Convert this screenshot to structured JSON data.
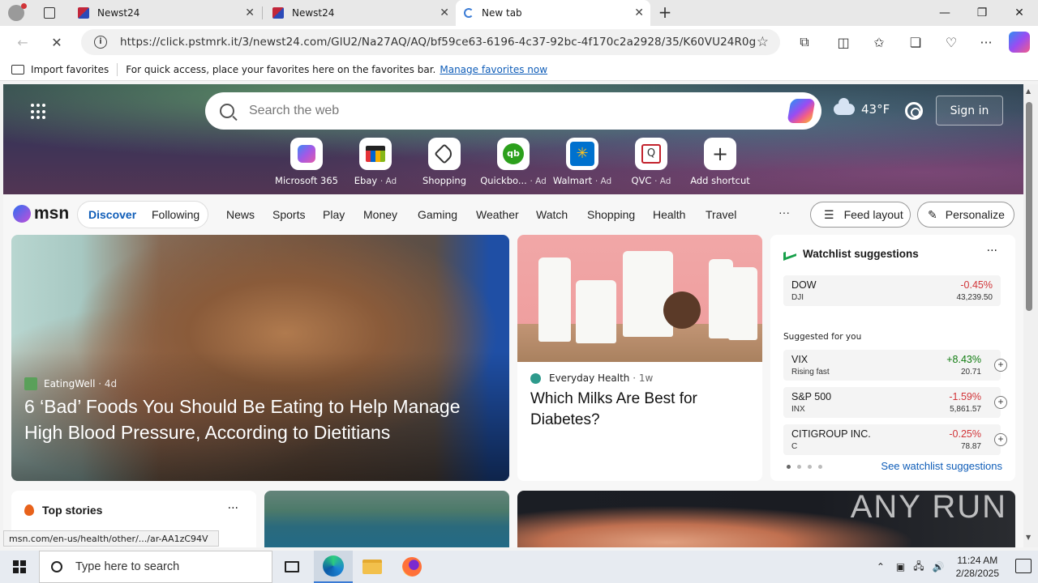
{
  "browser": {
    "tabs": [
      {
        "title": "Newst24",
        "active": false
      },
      {
        "title": "Newst24",
        "active": false
      },
      {
        "title": "New tab",
        "active": true
      }
    ],
    "url": "https://click.pstmrk.it/3/newst24.com/GlU2/Na27AQ/AQ/bf59ce63-6196-4c37-92bc-4f170c2a2928/35/K60VU24R0g",
    "favorites_bar": {
      "import_label": "Import favorites",
      "hint": "For quick access, place your favorites here on the favorites bar.",
      "manage_link": "Manage favorites now"
    }
  },
  "newtab": {
    "search_placeholder": "Search the web",
    "weather": {
      "temp": "43°F",
      "icon": "cloud-icon"
    },
    "signin_label": "Sign in",
    "shortcuts": [
      {
        "label": "Microsoft 365",
        "ad": ""
      },
      {
        "label": "Ebay",
        "ad": "· Ad"
      },
      {
        "label": "Shopping",
        "ad": ""
      },
      {
        "label": "Quickbo...",
        "ad": "· Ad"
      },
      {
        "label": "Walmart",
        "ad": "· Ad"
      },
      {
        "label": "QVC",
        "ad": "· Ad"
      },
      {
        "label": "Add shortcut",
        "ad": ""
      }
    ]
  },
  "msn": {
    "logo": "msn",
    "pill": {
      "discover": "Discover",
      "following": "Following"
    },
    "nav": [
      "News",
      "Sports",
      "Play",
      "Money",
      "Gaming",
      "Weather",
      "Watch",
      "Shopping",
      "Health",
      "Travel"
    ],
    "more": "···",
    "feed_layout": "Feed layout",
    "personalize": "Personalize"
  },
  "cards": {
    "hero": {
      "source": "EatingWell",
      "age": "· 4d",
      "title": "6 ‘Bad’ Foods You Should Be Eating to Help Manage High Blood Pressure, According to Dietitians"
    },
    "second": {
      "source": "Everyday Health",
      "age": "· 1w",
      "title": "Which Milks Are Best for Diabetes?"
    },
    "top_stories": {
      "title": "Top stories",
      "more": "···"
    }
  },
  "watchlist": {
    "title": "Watchlist suggestions",
    "more": "···",
    "main": {
      "name": "DOW",
      "ticker": "DJI",
      "pct": "-0.45%",
      "price": "43,239.50"
    },
    "suggested_label": "Suggested for you",
    "suggested": [
      {
        "name": "VIX",
        "ticker": "Rising fast",
        "pct": "+8.43%",
        "price": "20.71",
        "dir": "up"
      },
      {
        "name": "S&P 500",
        "ticker": "INX",
        "pct": "-1.59%",
        "price": "5,861.57",
        "dir": "down"
      },
      {
        "name": "CITIGROUP INC.",
        "ticker": "C",
        "pct": "-0.25%",
        "price": "78.87",
        "dir": "down"
      }
    ],
    "see_all": "See watchlist suggestions"
  },
  "status_url": "msn.com/en-us/health/other/.../ar-AA1zC94V",
  "watermark": "ANY RUN",
  "taskbar": {
    "search_placeholder": "Type here to search",
    "time": "11:24 AM",
    "date": "2/28/2025"
  }
}
